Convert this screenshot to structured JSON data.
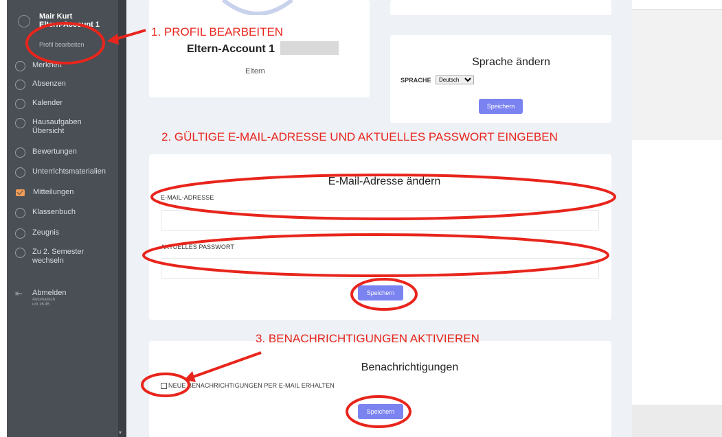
{
  "sidebar": {
    "user_name": "Mair Kurt",
    "account": "Eltern-Account 1",
    "edit_profile": "Profil bearbeiten",
    "items": [
      {
        "label": "Merkheft"
      },
      {
        "label": "Absenzen"
      },
      {
        "label": "Kalender"
      },
      {
        "label": "Hausaufgaben Übersicht"
      },
      {
        "label": "Bewertungen"
      },
      {
        "label": "Unterrichtsmaterialien"
      },
      {
        "label": "Mitteilungen"
      },
      {
        "label": "Klassenbuch"
      },
      {
        "label": "Zeugnis"
      },
      {
        "label": "Zu 2. Semester wechseln"
      }
    ],
    "logout_label": "Abmelden",
    "logout_sub": "Automatisch um 16:45"
  },
  "profile_card": {
    "account": "Eltern-Account 1",
    "role": "Eltern"
  },
  "language_card": {
    "title": "Sprache ändern",
    "label": "SPRACHE",
    "selected": "Deutsch",
    "save": "Speichern"
  },
  "email_card": {
    "title": "E-Mail-Adresse ändern",
    "email_label": "E-MAIL-ADRESSE",
    "password_label": "AKTUELLES PASSWORT",
    "save": "Speichern"
  },
  "notify_card": {
    "title": "Benachrichtigungen",
    "checkbox_label": "NEUE BENACHRICHTIGUNGEN PER E-MAIL ERHALTEN",
    "save": "Speichern"
  },
  "annotations": {
    "step1": "1. PROFIL BEARBEITEN",
    "step2": "2. GÜLTIGE E-MAIL-ADRESSE UND AKTUELLES PASSWORT EINGEBEN",
    "step3": "3. BENACHRICHTIGUNGEN AKTIVIEREN"
  },
  "colors": {
    "sidebar": "#4a4f55",
    "accent_button": "#7b83f0",
    "annotation_red": "#e8251c",
    "mail_icon": "#f29b55"
  }
}
